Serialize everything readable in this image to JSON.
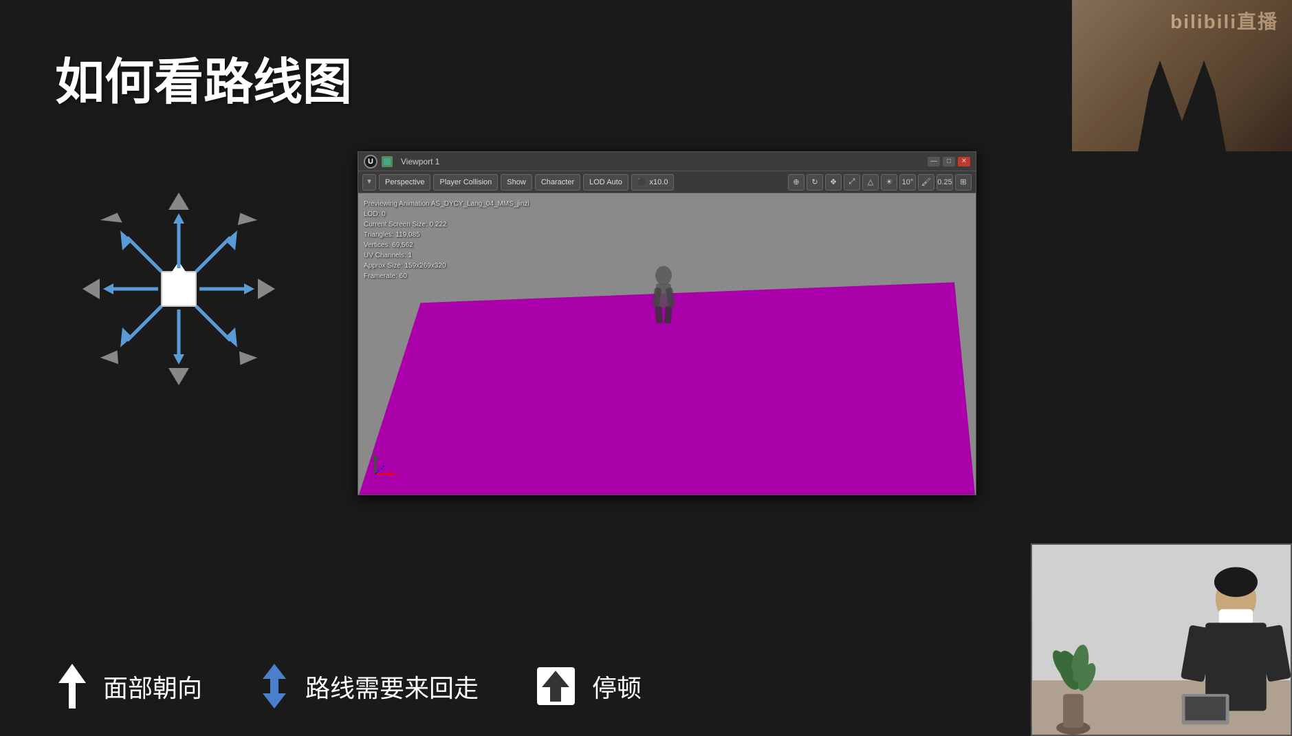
{
  "title": "如何看路线图",
  "bilibili_logo": "bilibili直播",
  "viewport": {
    "title": "Viewport 1",
    "toolbar": {
      "dropdown_label": "▼",
      "perspective_label": "Perspective",
      "player_collision_label": "Player Collision",
      "show_label": "Show",
      "character_label": "Character",
      "lod_auto_label": "LOD Auto",
      "zoom_label": "x10.0",
      "angle_label": "10°",
      "opacity_label": "0.25"
    },
    "info": {
      "line1": "Previewing Animation AS_DYCY_Lang_04_MMS_jinzi",
      "line2": "LOD: 0",
      "line3": "Current Screen Size: 0.222",
      "line4": "Triangles: 119,085",
      "line5": "Vertices: 69,562",
      "line6": "UV Channels: 1",
      "line7": "Approx Size: 159x269x320",
      "line8": "Framerate: 60"
    }
  },
  "bottom": {
    "item1_text": "面部朝向",
    "item2_text": "路线需要来回走",
    "item3_text": "停顿"
  }
}
